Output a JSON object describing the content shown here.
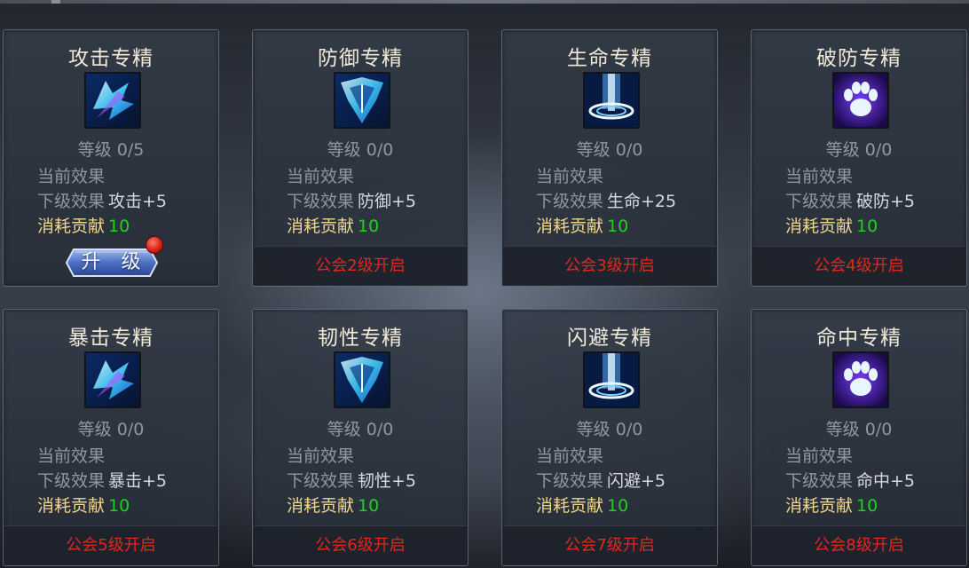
{
  "labels": {
    "level_prefix": "等级",
    "current_effect": "当前效果",
    "next_effect": "下级效果",
    "cost": "消耗贡献",
    "upgrade_button": "升 级"
  },
  "cards": [
    {
      "title": "攻击专精",
      "icon": "attack-icon",
      "level": "0/5",
      "next_value": "攻击+5",
      "cost_value": "10",
      "footer": ""
    },
    {
      "title": "防御专精",
      "icon": "defense-icon",
      "level": "0/0",
      "next_value": "防御+5",
      "cost_value": "10",
      "footer": "公会2级开启"
    },
    {
      "title": "生命专精",
      "icon": "life-icon",
      "level": "0/0",
      "next_value": "生命+25",
      "cost_value": "10",
      "footer": "公会3级开启"
    },
    {
      "title": "破防专精",
      "icon": "paw-icon",
      "level": "0/0",
      "next_value": "破防+5",
      "cost_value": "10",
      "footer": "公会4级开启"
    },
    {
      "title": "暴击专精",
      "icon": "attack-icon",
      "level": "0/0",
      "next_value": "暴击+5",
      "cost_value": "10",
      "footer": "公会5级开启"
    },
    {
      "title": "韧性专精",
      "icon": "defense-icon",
      "level": "0/0",
      "next_value": "韧性+5",
      "cost_value": "10",
      "footer": "公会6级开启"
    },
    {
      "title": "闪避专精",
      "icon": "life-icon",
      "level": "0/0",
      "next_value": "闪避+5",
      "cost_value": "10",
      "footer": "公会7级开启"
    },
    {
      "title": "命中专精",
      "icon": "paw-icon",
      "level": "0/0",
      "next_value": "命中+5",
      "cost_value": "10",
      "footer": "公会8级开启"
    }
  ],
  "colors": {
    "title": "#f2ead8",
    "label": "#8f97a3",
    "cost_label": "#f0d58a",
    "cost_value": "#20d020",
    "locked_text": "#e0281f"
  }
}
